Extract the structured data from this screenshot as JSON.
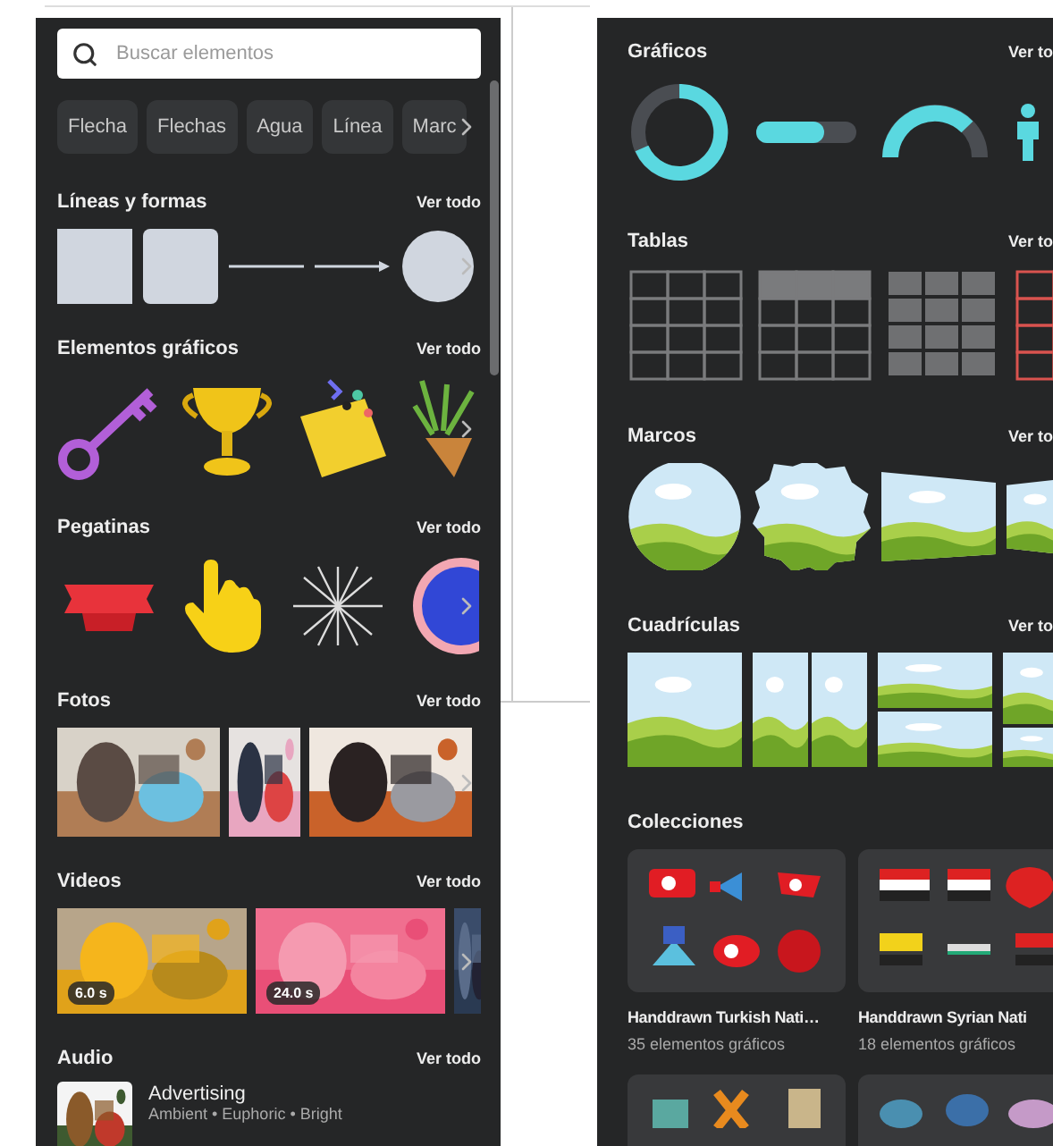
{
  "search": {
    "placeholder": "Buscar elementos"
  },
  "chips": [
    "Flecha",
    "Flechas",
    "Agua",
    "Línea",
    "Marc"
  ],
  "left_sections": [
    {
      "kind": "shapes",
      "title": "Líneas y formas",
      "link": "Ver todo"
    },
    {
      "kind": "graphics",
      "title": "Elementos gráficos",
      "link": "Ver todo"
    },
    {
      "kind": "stickers",
      "title": "Pegatinas",
      "link": "Ver todo"
    },
    {
      "kind": "photos",
      "title": "Fotos",
      "link": "Ver todo"
    },
    {
      "kind": "videos",
      "title": "Videos",
      "link": "Ver todo",
      "items": [
        {
          "duration": "6.0 s"
        },
        {
          "duration": "24.0 s"
        }
      ]
    },
    {
      "kind": "audio",
      "title": "Audio",
      "link": "Ver todo",
      "items": [
        {
          "title": "Advertising",
          "tags": "Ambient • Euphoric • Bright"
        }
      ]
    }
  ],
  "right_sections": [
    {
      "kind": "charts",
      "title": "Gráficos",
      "link": "Ver to"
    },
    {
      "kind": "tables",
      "title": "Tablas",
      "link": "Ver to"
    },
    {
      "kind": "frames",
      "title": "Marcos",
      "link": "Ver to"
    },
    {
      "kind": "grids",
      "title": "Cuadrículas",
      "link": "Ver to"
    },
    {
      "kind": "collections",
      "title": "Colecciones",
      "items": [
        {
          "name": "Handdrawn Turkish Nati…",
          "count": "35 elementos gráficos"
        },
        {
          "name": "Handdrawn Syrian Nati",
          "count": "18 elementos gráficos"
        }
      ]
    }
  ]
}
